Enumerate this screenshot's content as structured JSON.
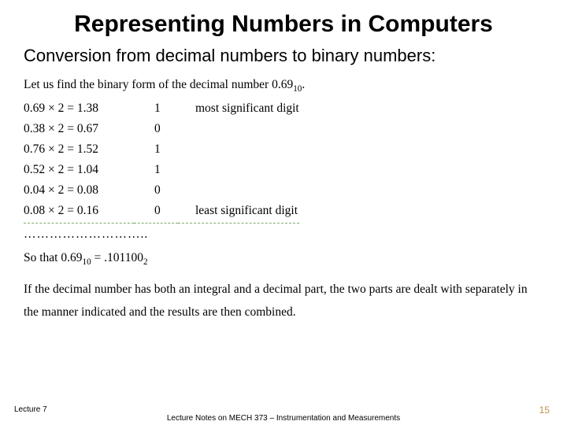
{
  "title": "Representing Numbers in Computers",
  "subtitle": "Conversion from decimal numbers to binary numbers:",
  "intro_prefix": "Let us find the binary form of the decimal number 0.69",
  "intro_sub": "10",
  "intro_suffix": ".",
  "steps": [
    {
      "eq": "0.69 × 2 = 1.38",
      "bit": "1",
      "note": "most significant digit"
    },
    {
      "eq": "0.38 × 2 = 0.67",
      "bit": "0",
      "note": ""
    },
    {
      "eq": "0.76 × 2 = 1.52",
      "bit": "1",
      "note": ""
    },
    {
      "eq": "0.52 × 2 = 1.04",
      "bit": "1",
      "note": ""
    },
    {
      "eq": "0.04 × 2 = 0.08",
      "bit": "0",
      "note": ""
    },
    {
      "eq": "0.08 × 2 = 0.16",
      "bit": "0",
      "note": "least significant digit"
    }
  ],
  "dots": "………………………..",
  "result_prefix": "So that 0.69",
  "result_sub1": "10",
  "result_mid": " = .101100",
  "result_sub2": "2",
  "combined": "If the decimal number has both an integral and a decimal part, the two parts are dealt with separately in the manner indicated and the results are then combined.",
  "footer_left": "Lecture 7",
  "footer_center": "Lecture Notes on MECH 373 – Instrumentation and Measurements",
  "page_number": "15"
}
